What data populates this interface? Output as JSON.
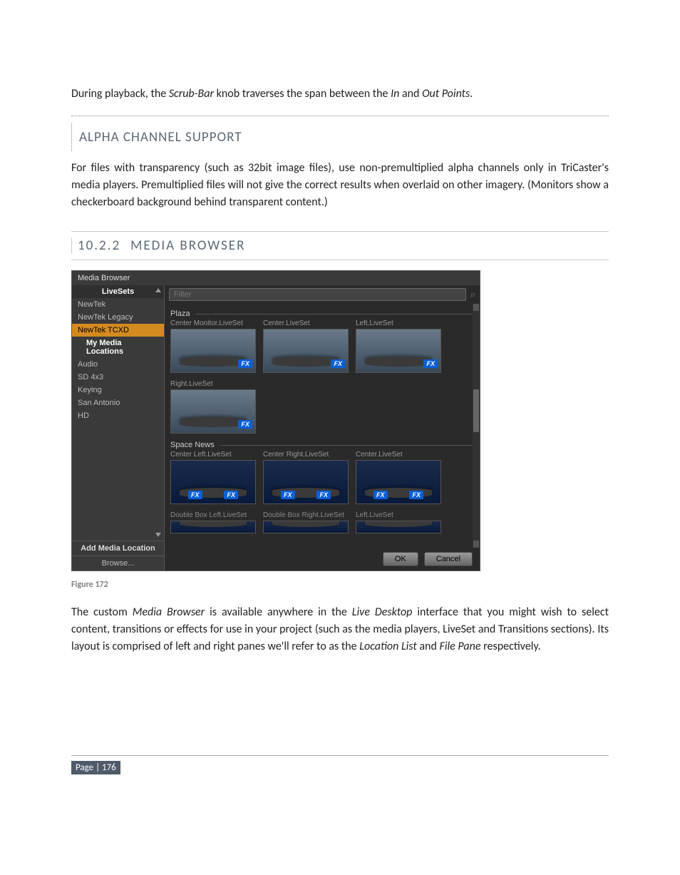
{
  "intro": {
    "pre": "During playback, the ",
    "scrub": "Scrub-Bar",
    "mid": " knob traverses the span between the ",
    "in": "In",
    "and": " and ",
    "out": "Out Points",
    "end": "."
  },
  "alpha": {
    "heading": "ALPHA CHANNEL SUPPORT",
    "text": "For files with transparency (such as 32bit image files), use non-premultiplied alpha channels only in TriCaster's media players.  Premultiplied files will not give the correct results when overlaid on other imagery.  (Monitors show a checkerboard background behind transparent content.)"
  },
  "mb_heading": {
    "num": "10.2.2",
    "title": "MEDIA BROWSER"
  },
  "browser": {
    "title": "Media Browser",
    "left_header": "LiveSets",
    "locations": [
      {
        "label": "NewTek",
        "selected": false
      },
      {
        "label": "NewTek Legacy",
        "selected": false
      },
      {
        "label": "NewTek TCXD",
        "selected": true
      },
      {
        "label": "My Media Locations",
        "selected": false,
        "sub": true
      },
      {
        "label": "Audio",
        "selected": false
      },
      {
        "label": "SD 4x3",
        "selected": false
      },
      {
        "label": "Keying",
        "selected": false
      },
      {
        "label": "San Antonio",
        "selected": false
      },
      {
        "label": "HD",
        "selected": false
      }
    ],
    "add_label": "Add Media Location",
    "browse_label": "Browse...",
    "filter_placeholder": "Filter",
    "groups": [
      {
        "name": "Plaza",
        "thumbs": [
          {
            "label": "Center Monitor.LiveSet",
            "fx": "FX"
          },
          {
            "label": "Center.LiveSet",
            "fx": "FX"
          },
          {
            "label": "Left.LiveSet",
            "fx": "FX"
          },
          {
            "label": "Right.LiveSet",
            "fx": "FX"
          }
        ]
      },
      {
        "name": "Space News",
        "thumbs": [
          {
            "label": "Center Left.LiveSet",
            "fx2": true
          },
          {
            "label": "Center Right.LiveSet",
            "fx2": true
          },
          {
            "label": "Center.LiveSet",
            "fx2": true
          }
        ],
        "clipped_row": [
          {
            "label": "Double Box Left.LiveSet"
          },
          {
            "label": "Double Box Right.LiveSet"
          },
          {
            "label": "Left.LiveSet"
          }
        ]
      }
    ],
    "ok": "OK",
    "cancel": "Cancel"
  },
  "figure_caption": "Figure 172",
  "closing": {
    "p1a": "The custom ",
    "p1b": "Media Browser",
    "p1c": " is available anywhere in the ",
    "p1d": "Live Desktop",
    "p1e": " interface that you might wish to select content, transitions or effects for use in your project (such as the media players, LiveSet and Transitions sections).  Its layout is comprised of left and right panes we'll refer to as the ",
    "p1f": "Location List",
    "p1g": " and ",
    "p1h": "File Pane",
    "p1i": " respectively."
  },
  "page_footer": "Page | 176"
}
